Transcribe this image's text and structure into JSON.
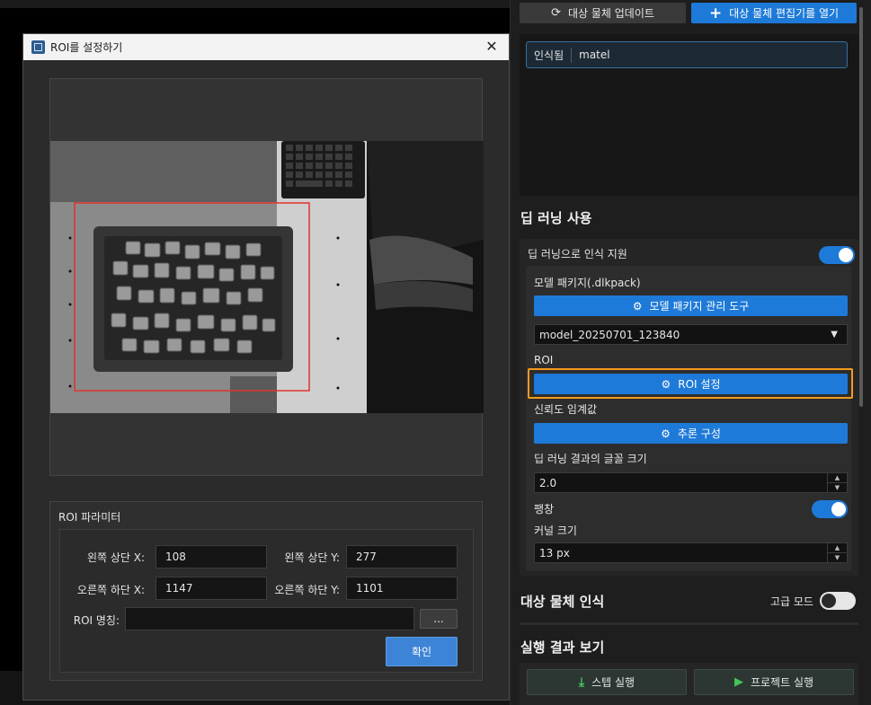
{
  "right_panel": {
    "update_button": "대상 물체 업데이트",
    "editor_button": "대상 물체 편집기를 열기",
    "recognized_list": [
      {
        "status": "인식됨",
        "name": "matel"
      }
    ],
    "deep_learning": {
      "title": "딥 러닝 사용",
      "assist_label": "딥 러닝으로 인식 지원",
      "model_package_label": "모델 패키지(.dlkpack)",
      "model_tool_button": "모델 패키지 관리 도구",
      "model_select_value": "model_20250701_123840",
      "roi_label": "ROI",
      "roi_button": "ROI 설정",
      "confidence_label": "신뢰도 임계값",
      "inference_button": "추론 구성",
      "font_size_label": "딥 러닝 결과의 글꼴 크기",
      "font_size_value": "2.0",
      "dilate_label": "팽창",
      "kernel_label": "커널 크기",
      "kernel_value": "13 px"
    },
    "recognition": {
      "title": "대상 물체 인식",
      "advanced_label": "고급 모드"
    },
    "results": {
      "title": "실행 결과 보기",
      "step_button": "스텝 실행",
      "project_button": "프로젝트 실행"
    },
    "colors": {
      "accent": "#1e7ad8",
      "highlight": "#f39a1e",
      "play_green": "#45c45a"
    }
  },
  "dialog": {
    "title": "ROI를 설정하기",
    "params_title": "ROI 파라미터",
    "top_left_x_label": "왼쪽 상단 X:",
    "top_left_x_value": "108",
    "top_left_y_label": "왼쪽 상단 Y:",
    "top_left_y_value": "277",
    "bottom_right_x_label": "오른쪽 하단 X:",
    "bottom_right_x_value": "1147",
    "bottom_right_y_label": "오른쪽 하단 Y:",
    "bottom_right_y_value": "1101",
    "roi_name_label": "ROI 명칭:",
    "roi_name_value": "",
    "browse_button": "...",
    "confirm_button": "확인",
    "roi_color": "#e0322f"
  }
}
